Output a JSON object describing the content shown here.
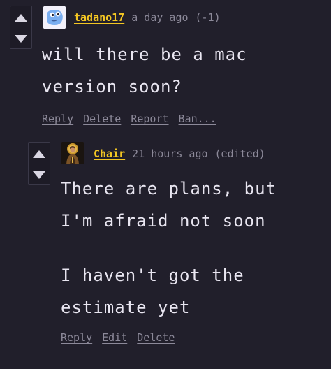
{
  "comments": [
    {
      "author": "tadano17",
      "timestamp": "a day ago",
      "score": "(-1)",
      "body_lines": [
        "will there be a mac",
        "version soon?"
      ],
      "actions": [
        "Reply",
        "Delete",
        "Report",
        "Ban..."
      ],
      "avatar_icon": "blue-blob-avatar"
    },
    {
      "author": "Chair",
      "timestamp": "21 hours ago",
      "edited": "(edited)",
      "body_lines": [
        "There are plans, but",
        "I'm afraid not soon",
        "I haven't got the",
        "estimate yet"
      ],
      "actions": [
        "Reply",
        "Edit",
        "Delete"
      ],
      "avatar_icon": "saint-portrait-avatar"
    }
  ],
  "colors": {
    "background": "#211f2b",
    "username": "#f3c623",
    "muted": "#8c8999",
    "text": "#e9e6f1"
  },
  "icons": {
    "upvote": "triangle-up-icon",
    "downvote": "triangle-down-icon"
  }
}
